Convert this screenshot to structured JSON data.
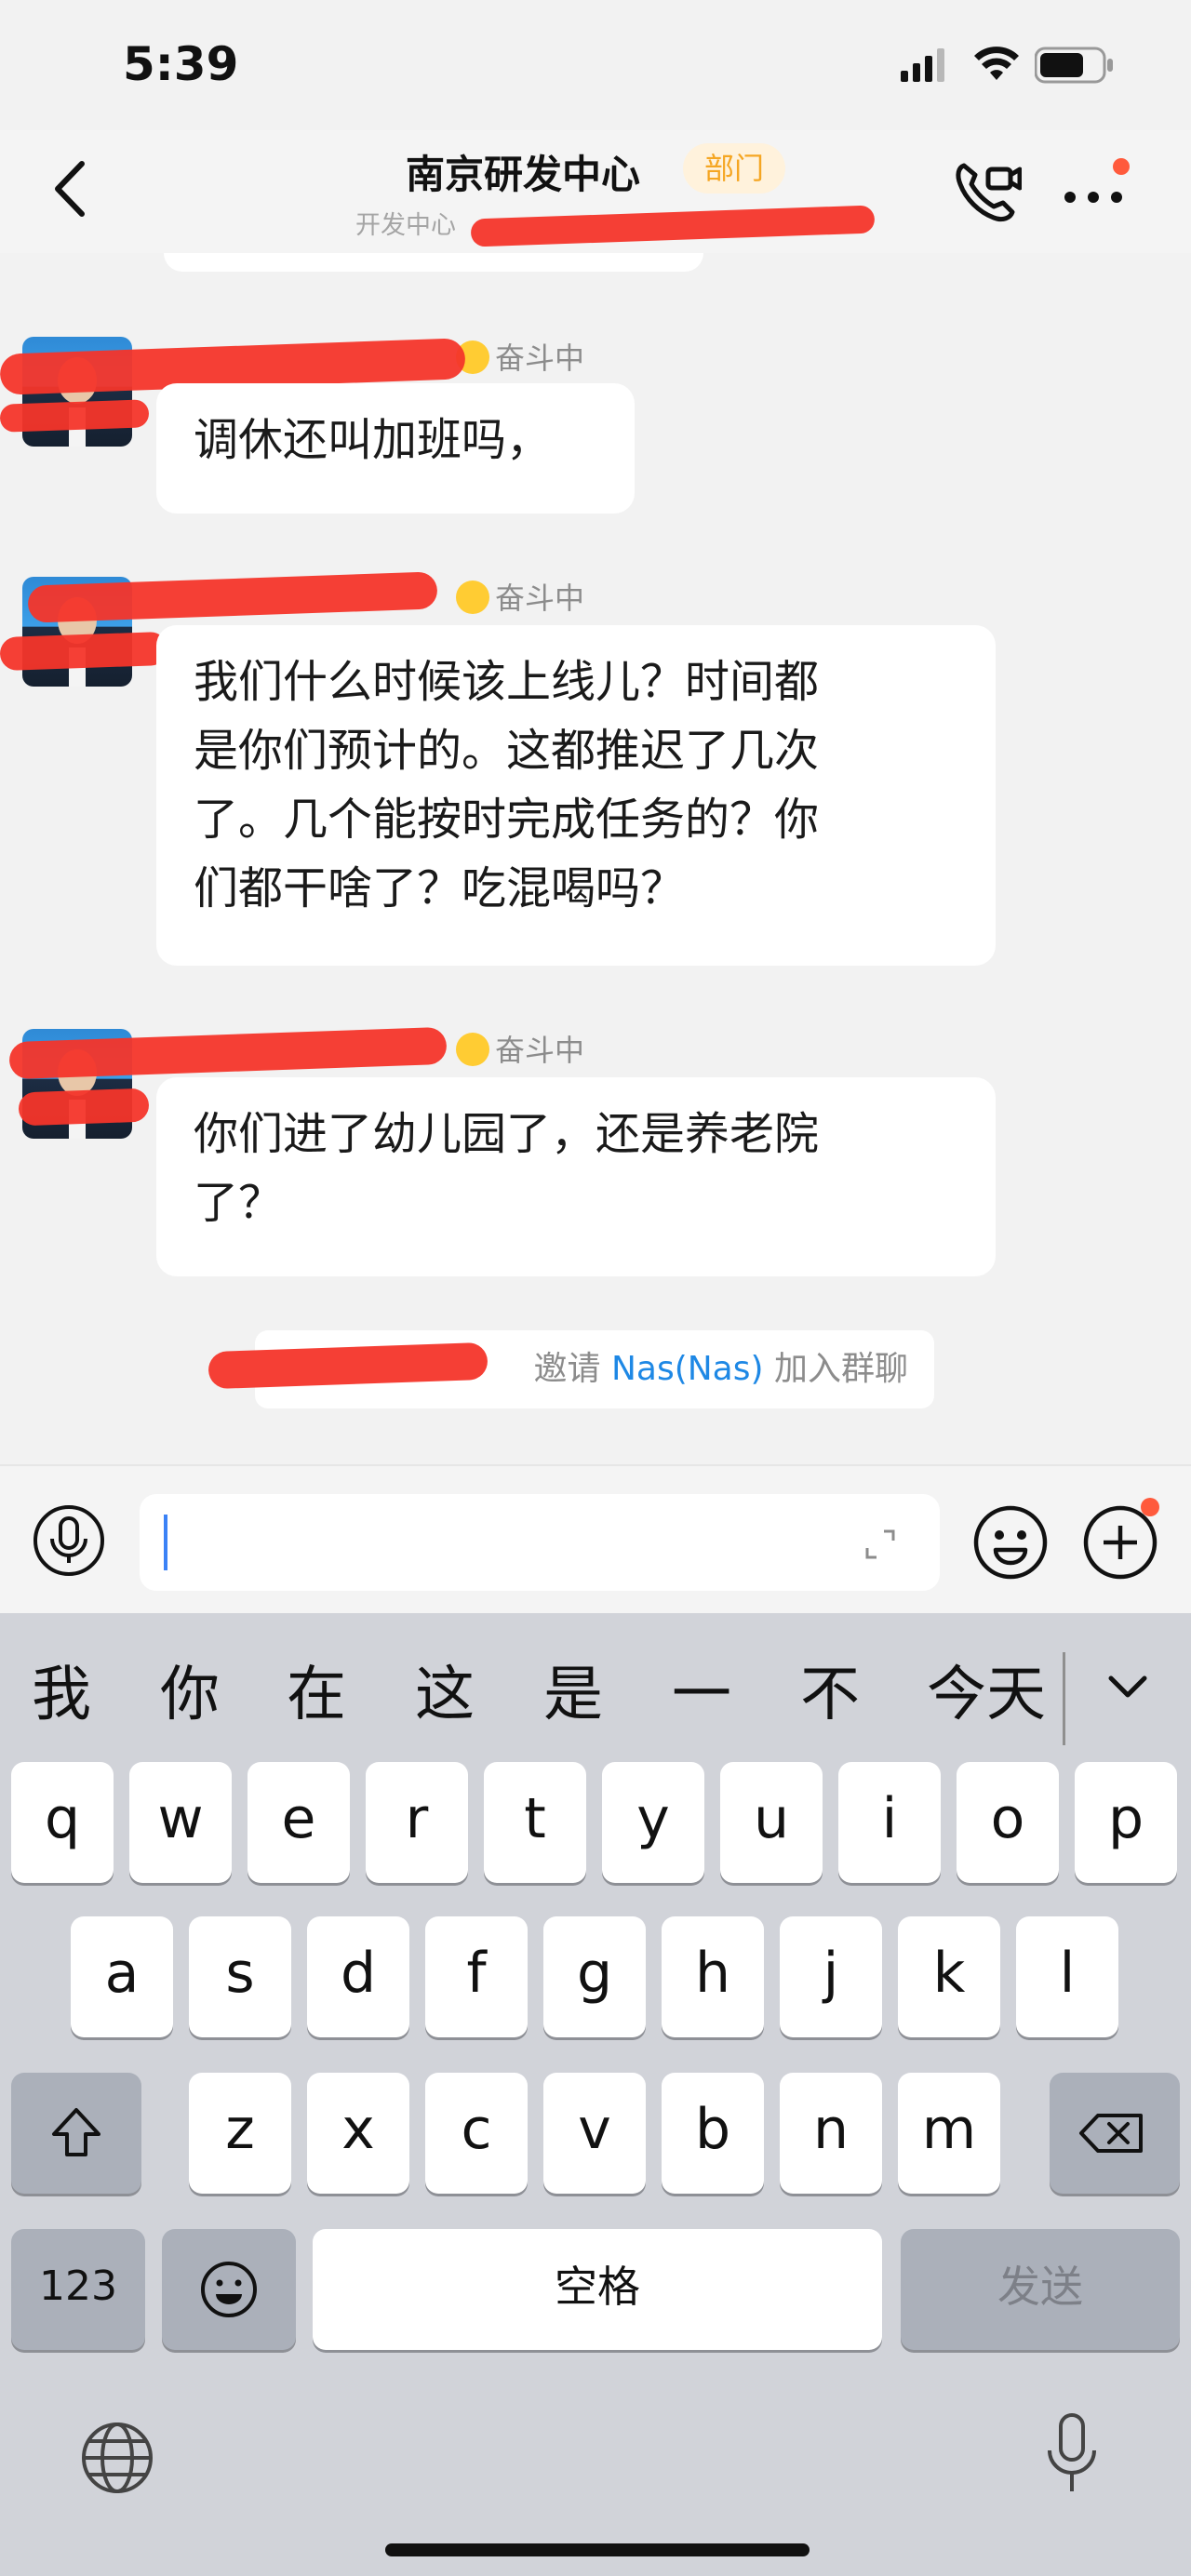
{
  "status_bar": {
    "time": "5:39"
  },
  "header": {
    "title": "南京研发中心",
    "badge": "部门",
    "subtitle": "开发中心"
  },
  "chat": {
    "messages": [
      {
        "status": "奋斗中",
        "text_lines": [
          "调休还叫加班吗，"
        ]
      },
      {
        "status": "奋斗中",
        "text_lines": [
          "我们什么时候该上线儿？时间都",
          "是你们预计的。这都推迟了几次",
          "了。几个能按时完成任务的？你",
          "们都干啥了？吃混喝吗？"
        ]
      },
      {
        "status": "奋斗中",
        "text_lines": [
          "你们进了幼儿园了，还是养老院",
          "了？"
        ]
      }
    ],
    "system_message": {
      "prefix": "邀请 ",
      "name": "Nas(Nas)",
      "suffix": " 加入群聊"
    }
  },
  "input_bar": {
    "value": "",
    "placeholder": ""
  },
  "keyboard": {
    "candidates": [
      "我",
      "你",
      "在",
      "这",
      "是",
      "一",
      "不",
      "今天"
    ],
    "row1": [
      "q",
      "w",
      "e",
      "r",
      "t",
      "y",
      "u",
      "i",
      "o",
      "p"
    ],
    "row2": [
      "a",
      "s",
      "d",
      "f",
      "g",
      "h",
      "j",
      "k",
      "l"
    ],
    "row3": [
      "z",
      "x",
      "c",
      "v",
      "b",
      "n",
      "m"
    ],
    "numbers_key": "123",
    "space_key": "空格",
    "send_key": "发送"
  },
  "colors": {
    "accent_blue": "#1e88e5",
    "badge_orange": "#f5a623",
    "notification_red": "#ff5a3c",
    "redaction_red": "#f4352a"
  }
}
